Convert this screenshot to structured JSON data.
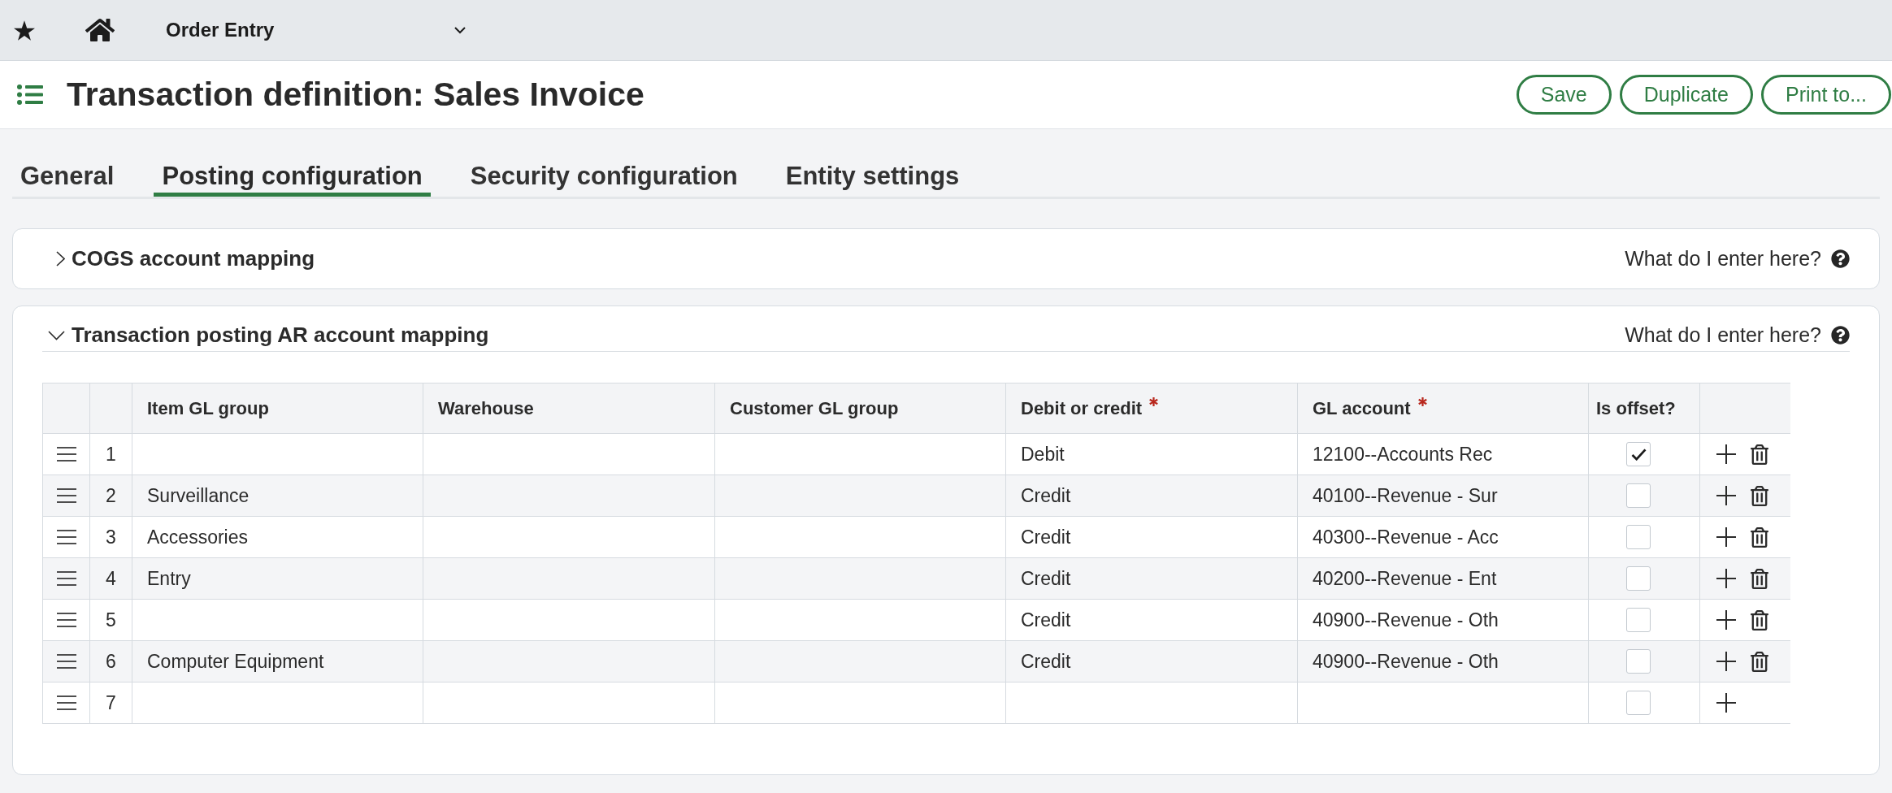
{
  "top_bar": {
    "module": "Order Entry"
  },
  "header": {
    "title": "Transaction definition: Sales Invoice",
    "buttons": [
      "Save",
      "Duplicate",
      "Print to..."
    ]
  },
  "tabs": [
    {
      "label": "General",
      "selected": false
    },
    {
      "label": "Posting configuration",
      "selected": true
    },
    {
      "label": "Security configuration",
      "selected": false
    },
    {
      "label": "Entity settings",
      "selected": false
    }
  ],
  "panels": [
    {
      "title": "COGS account mapping",
      "expanded": false,
      "help": "What do I enter here?"
    },
    {
      "title": "Transaction posting AR account mapping",
      "expanded": true,
      "help": "What do I enter here?",
      "table": {
        "columns": [
          {
            "label": "Item GL group",
            "required": false
          },
          {
            "label": "Warehouse",
            "required": false
          },
          {
            "label": "Customer GL group",
            "required": false
          },
          {
            "label": "Debit or credit",
            "required": true
          },
          {
            "label": "GL account",
            "required": true
          },
          {
            "label": "Is offset?",
            "required": false
          }
        ],
        "rows": [
          {
            "number": "1",
            "debit_or_credit": "Debit",
            "gl_account": "12100--Accounts Rec",
            "is_offset": true,
            "removable": true
          },
          {
            "number": "2",
            "item_gl_group": "Surveillance",
            "debit_or_credit": "Credit",
            "gl_account": "40100--Revenue - Sur",
            "is_offset": false,
            "removable": true
          },
          {
            "number": "3",
            "item_gl_group": "Accessories",
            "debit_or_credit": "Credit",
            "gl_account": "40300--Revenue - Acc",
            "is_offset": false,
            "removable": true
          },
          {
            "number": "4",
            "item_gl_group": "Entry",
            "debit_or_credit": "Credit",
            "gl_account": "40200--Revenue - Ent",
            "is_offset": false,
            "removable": true
          },
          {
            "number": "5",
            "debit_or_credit": "Credit",
            "gl_account": "40900--Revenue - Oth",
            "is_offset": false,
            "removable": true
          },
          {
            "number": "6",
            "item_gl_group": "Computer Equipment",
            "debit_or_credit": "Credit",
            "gl_account": "40900--Revenue - Oth",
            "is_offset": false,
            "removable": true
          },
          {
            "number": "7",
            "is_offset": false,
            "removable": false
          }
        ]
      }
    }
  ]
}
